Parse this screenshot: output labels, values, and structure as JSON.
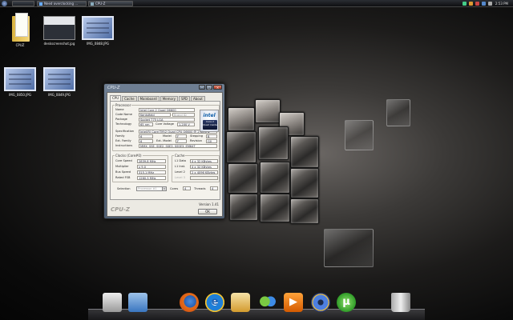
{
  "taskbar": {
    "tasks": [
      {
        "label": "Need overclocking ..."
      },
      {
        "label": "CPU-Z"
      }
    ],
    "clock": "2:53 PM"
  },
  "desktop": {
    "icons": [
      {
        "label": "CPUZ"
      },
      {
        "label": "deskscreenshot.jpg"
      },
      {
        "label": "IMG_0848.JPG"
      },
      {
        "label": "IMG_0850.JPG"
      },
      {
        "label": "IMG_0849.JPG"
      }
    ]
  },
  "cpuz": {
    "title": "CPU-Z",
    "tabs": [
      "CPU",
      "Cache",
      "Mainboard",
      "Memory",
      "SPD",
      "About"
    ],
    "processor": {
      "group": "Processor",
      "name_label": "Name",
      "name": "Intel Core 2 Quad Q6600",
      "codename_label": "Code Name",
      "codename": "Kentsfield",
      "brand_label": "Brand ID",
      "package_label": "Package",
      "package": "Socket 775 LGA",
      "technology_label": "Technology",
      "technology": "65 nm",
      "voltage_label": "Core Voltage",
      "voltage": "1.200 V",
      "spec_label": "Specification",
      "spec": "Intel(R) Core(TM)2 Quad CPU    Q6600  @ 2.40GHz",
      "family_label": "Family",
      "family": "6",
      "model_label": "Model",
      "model": "F",
      "stepping_label": "Stepping",
      "stepping": "B",
      "extfamily_label": "Ext. Family",
      "extfamily": "6",
      "extmodel_label": "Ext. Model",
      "extmodel": "F",
      "revision_label": "Revision",
      "revision": "G0",
      "instructions_label": "Instructions",
      "instructions": "MMX, SSE, SSE2, SSE3, SSSE3, EM64T"
    },
    "clocks": {
      "group": "Clocks (Core#0)",
      "core_speed_label": "Core Speed",
      "core_speed": "2839.8 MHz",
      "multiplier_label": "Multiplier",
      "multiplier": "x 9.0",
      "bus_speed_label": "Bus Speed",
      "bus_speed": "315.1 MHz",
      "rated_fsb_label": "Rated FSB",
      "rated_fsb": "1260.3 MHz"
    },
    "cache": {
      "group": "Cache",
      "l1d_label": "L1 Data",
      "l1d": "4 x 32 KBytes",
      "l1i_label": "L1 Inst.",
      "l1i": "4 x 32 KBytes",
      "l2_label": "Level 2",
      "l2": "2 x 4096 KBytes",
      "l3_label": "Level 3"
    },
    "selection": {
      "label": "Selection",
      "value": "Processor #1",
      "cores_label": "Cores",
      "cores": "4",
      "threads_label": "Threads",
      "threads": "4"
    },
    "intel_logo": {
      "word": "intel",
      "badge": "Core 2 Quad inside"
    },
    "footer_logo": "CPU-Z",
    "version": "Version 1.41",
    "ok": "OK"
  },
  "dock": {
    "icons": [
      "mac-drive-icon",
      "folder-icon",
      "firefox-icon",
      "internet-explorer-icon",
      "explorer-icon",
      "messenger-icon",
      "media-player-icon",
      "dvd-icon",
      "utorrent-icon",
      "trash-icon"
    ]
  }
}
